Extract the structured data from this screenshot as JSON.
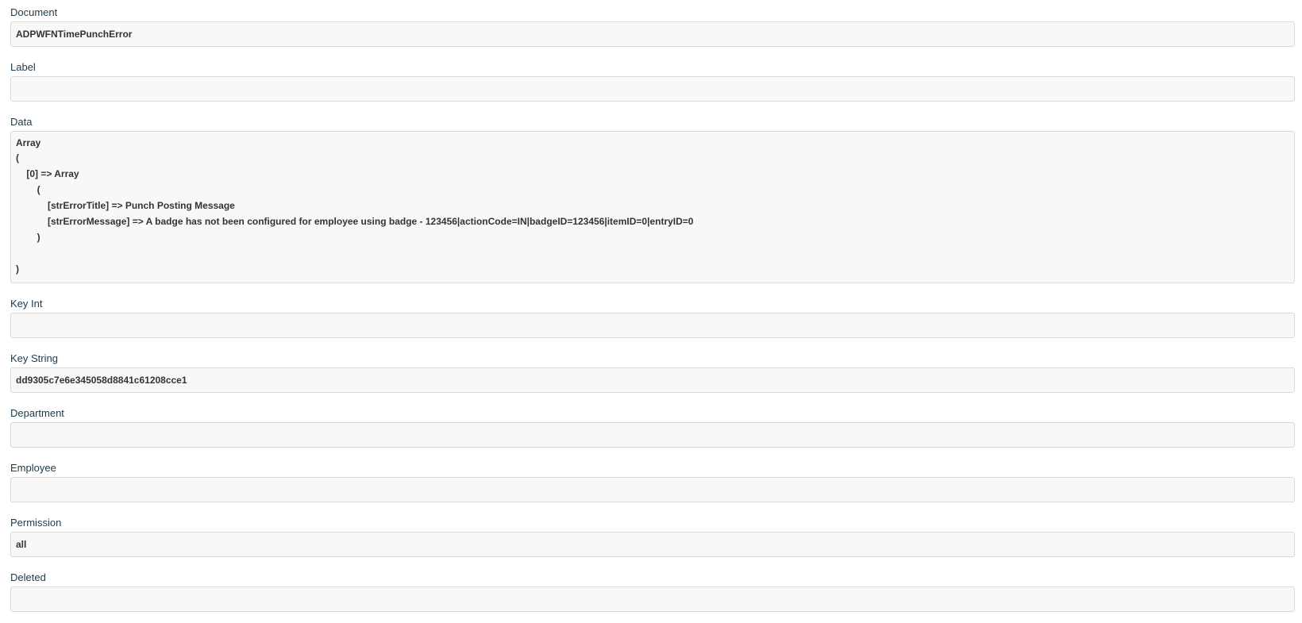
{
  "fields": {
    "document": {
      "label": "Document",
      "value": "ADPWFNTimePunchError"
    },
    "label": {
      "label": "Label",
      "value": ""
    },
    "data": {
      "label": "Data",
      "lines": [
        "Array",
        "(",
        "    [0] => Array",
        "        (",
        "            [strErrorTitle] => Punch Posting Message",
        "            [strErrorMessage] => A badge has not been configured for employee using badge - 123456|actionCode=IN|badgeID=123456|itemID=0|entryID=0",
        "        )",
        "",
        ")"
      ]
    },
    "key_int": {
      "label": "Key Int",
      "value": ""
    },
    "key_string": {
      "label": "Key String",
      "value": "dd9305c7e6e345058d8841c61208cce1"
    },
    "department": {
      "label": "Department",
      "value": ""
    },
    "employee": {
      "label": "Employee",
      "value": ""
    },
    "permission": {
      "label": "Permission",
      "value": "all"
    },
    "deleted": {
      "label": "Deleted",
      "value": ""
    }
  }
}
